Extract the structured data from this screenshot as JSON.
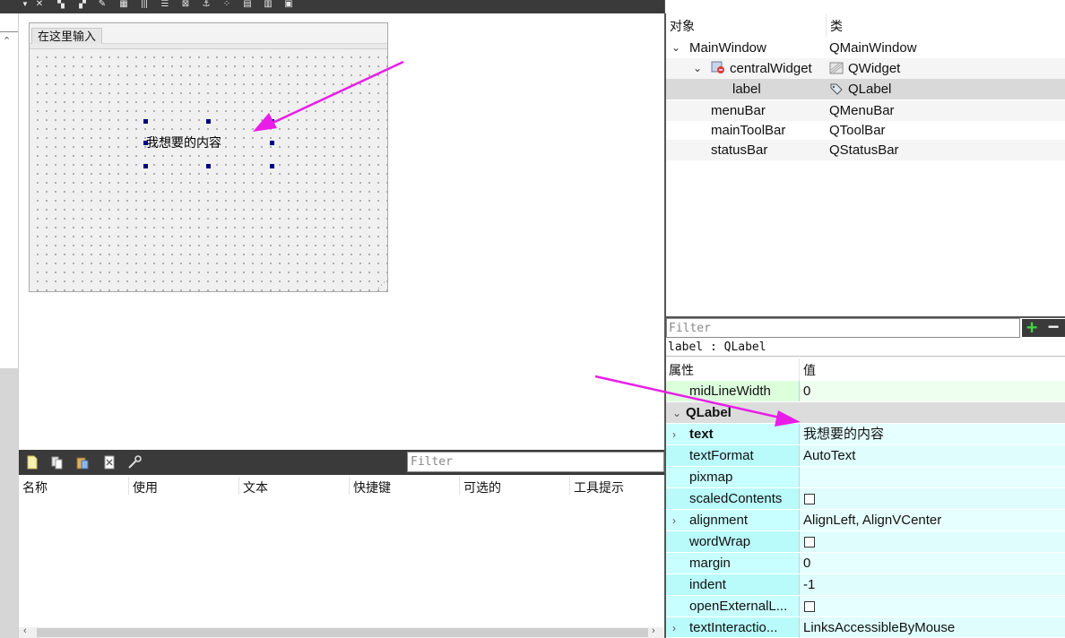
{
  "form": {
    "menu_placeholder": "在这里输入",
    "label_text": "我想要的内容"
  },
  "action_editor": {
    "filter_placeholder": "Filter",
    "columns": [
      "名称",
      "使用",
      "文本",
      "快捷键",
      "可选的",
      "工具提示"
    ]
  },
  "object_inspector": {
    "header_object": "对象",
    "header_class": "类",
    "rows": [
      {
        "name": "MainWindow",
        "type": "QMainWindow"
      },
      {
        "name": "centralWidget",
        "type": "QWidget"
      },
      {
        "name": "label",
        "type": "QLabel"
      },
      {
        "name": "menuBar",
        "type": "QMenuBar"
      },
      {
        "name": "mainToolBar",
        "type": "QToolBar"
      },
      {
        "name": "statusBar",
        "type": "QStatusBar"
      }
    ]
  },
  "property_editor": {
    "filter_placeholder": "Filter",
    "object_line": "label : QLabel",
    "header_property": "属性",
    "header_value": "值",
    "rows": [
      {
        "name": "midLineWidth",
        "value": "0"
      },
      {
        "name": "QLabel"
      },
      {
        "name": "text",
        "value": "我想要的内容"
      },
      {
        "name": "textFormat",
        "value": "AutoText"
      },
      {
        "name": "pixmap",
        "value": ""
      },
      {
        "name": "scaledContents",
        "checked": false
      },
      {
        "name": "alignment",
        "value": "AlignLeft, AlignVCenter"
      },
      {
        "name": "wordWrap",
        "checked": false
      },
      {
        "name": "margin",
        "value": "0"
      },
      {
        "name": "indent",
        "value": "-1"
      },
      {
        "name": "openExternalL...",
        "checked": false
      },
      {
        "name": "textInteractio...",
        "value": "LinksAccessibleByMouse"
      }
    ]
  },
  "colors": {
    "annotation_arrow": "#e81ee8",
    "selection_handle": "#000080",
    "add_button": "#3fd33f",
    "row_green": "#dcffdc",
    "row_cyan": "#c8ffff"
  },
  "icons": {
    "toolbar": [
      "dropdown-icon",
      "close-icon",
      "layout-horizontal-icon",
      "layout-vertical-icon",
      "edit-buddies-icon",
      "edit-tab-order-icon",
      "layout-columns-icon",
      "layout-rows-icon",
      "adjust-size-icon",
      "anchor-icon",
      "grid-icon",
      "preview-icon"
    ],
    "action_toolbar": [
      "new-action-icon",
      "copy-action-icon",
      "paste-action-icon",
      "delete-action-icon",
      "settings-wrench-icon"
    ]
  }
}
